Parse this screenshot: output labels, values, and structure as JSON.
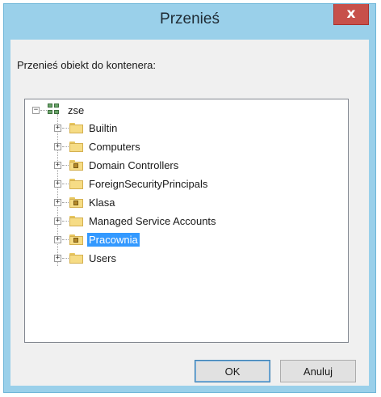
{
  "window": {
    "title": "Przenieś",
    "close_glyph": "x"
  },
  "prompt": "Przenieś obiekt do kontenera:",
  "tree": {
    "root": {
      "label": "zse",
      "icon": "domain-icon",
      "expander": "−"
    },
    "items": [
      {
        "label": "Builtin",
        "icon": "folder-icon",
        "expander": "+",
        "selected": false
      },
      {
        "label": "Computers",
        "icon": "folder-icon",
        "expander": "+",
        "selected": false
      },
      {
        "label": "Domain Controllers",
        "icon": "ou-folder-icon",
        "expander": "+",
        "selected": false
      },
      {
        "label": "ForeignSecurityPrincipals",
        "icon": "folder-icon",
        "expander": "+",
        "selected": false
      },
      {
        "label": "Klasa",
        "icon": "ou-folder-icon",
        "expander": "+",
        "selected": false
      },
      {
        "label": "Managed Service Accounts",
        "icon": "folder-icon",
        "expander": "+",
        "selected": false
      },
      {
        "label": "Pracownia",
        "icon": "ou-folder-icon",
        "expander": "+",
        "selected": true
      },
      {
        "label": "Users",
        "icon": "folder-icon",
        "expander": "+",
        "selected": false
      }
    ]
  },
  "buttons": {
    "ok": "OK",
    "cancel": "Anuluj"
  },
  "colors": {
    "frame": "#9ad0ea",
    "close": "#c7504a",
    "selection": "#3399ff"
  }
}
